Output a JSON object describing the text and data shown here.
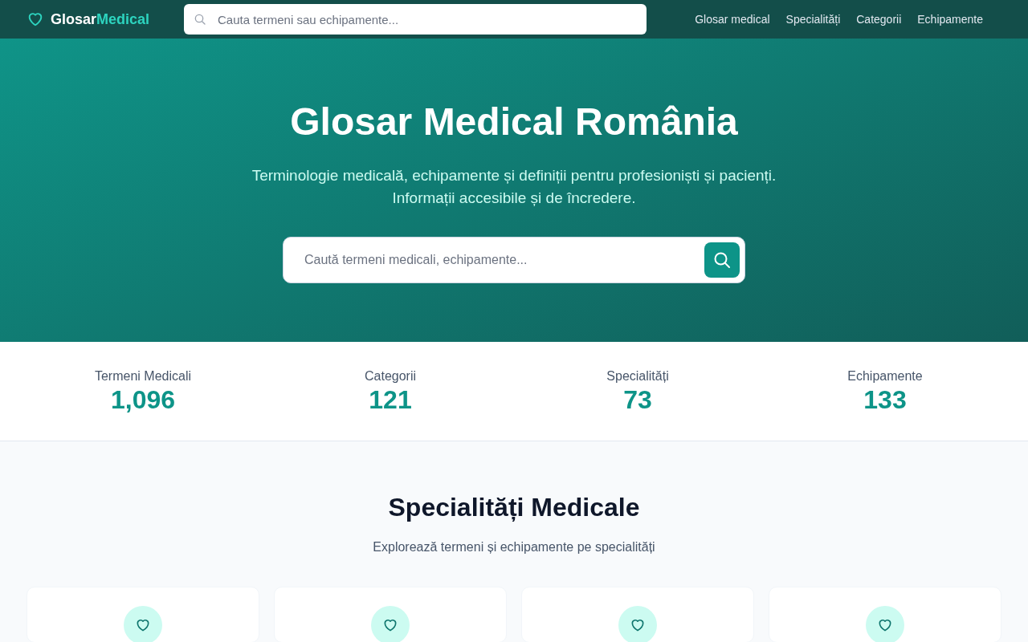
{
  "header": {
    "logo": {
      "text": "Glosar",
      "accent": "Medical"
    },
    "search": {
      "placeholder": "Cauta termeni sau echipamente..."
    },
    "nav": [
      "Glosar medical",
      "Specialități",
      "Categorii",
      "Echipamente"
    ]
  },
  "hero": {
    "title": "Glosar Medical România",
    "subtitle": [
      "Terminologie medicală, echipamente și definiții pentru profesioniști și pacienți.",
      "Informații accesibile și de încredere."
    ],
    "search": {
      "placeholder": "Caută termeni medicali, echipamente..."
    }
  },
  "stats": [
    {
      "label": "Termeni Medicali",
      "value": "1,096"
    },
    {
      "label": "Categorii",
      "value": "121"
    },
    {
      "label": "Specialități",
      "value": "73"
    },
    {
      "label": "Echipamente",
      "value": "133"
    }
  ],
  "specialties": {
    "title": "Specialități Medicale",
    "subtitle": "Explorează termeni și echipamente pe specialități",
    "cards": [
      {
        "kind": "heart"
      },
      {
        "kind": "heart"
      },
      {
        "kind": "heart"
      },
      {
        "kind": "heart"
      }
    ]
  }
}
